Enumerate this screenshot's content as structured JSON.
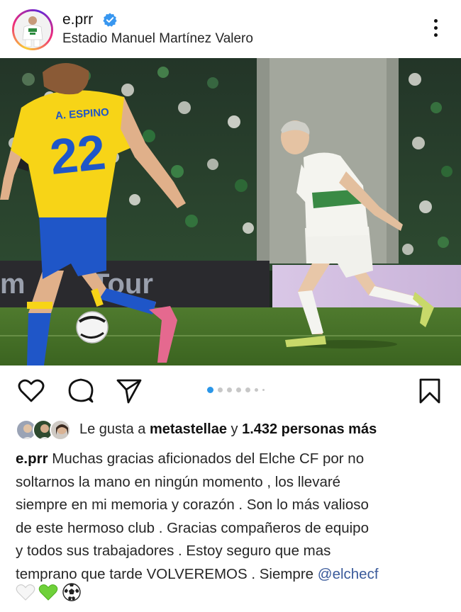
{
  "post": {
    "username": "e.prr",
    "verified": true,
    "location": "Estadio Manuel Martínez Valero"
  },
  "photo": {
    "player_number": "22",
    "player_name": "A. ESPINO",
    "board_text": "Tour",
    "board_text_left": "m"
  },
  "carousel": {
    "count": 7,
    "active_index": 0
  },
  "likes": {
    "prefix": "Le gusta a",
    "liked_by": "metastellae",
    "conjunction": "y",
    "others": "1.432 personas más"
  },
  "caption": {
    "username": "e.prr",
    "line1": " Muchas gracias  aficionados del Elche CF por no",
    "line2": "soltarnos la mano en ningún momento , los llevaré",
    "line3": "siempre en mi memoria y corazón . Son lo más valioso",
    "line4": "de este hermoso club .  Gracias compañeros de equipo",
    "line5": "y todos sus trabajadores . Estoy seguro que mas",
    "line6": "temprano que tarde VOLVEREMOS .  Siempre ",
    "mention": "@elchecf",
    "emojis": [
      "white-heart",
      "green-heart",
      "soccer-ball"
    ]
  },
  "icons": {
    "like": "heart-icon",
    "comment": "comment-icon",
    "share": "send-icon",
    "save": "bookmark-icon",
    "more": "more-vertical-icon",
    "verified": "verified-badge-icon"
  },
  "colors": {
    "verified_blue": "#3897f0",
    "carousel_active": "#2a96e8",
    "elche_green": "#1f8a3b",
    "cadiz_yellow": "#f7d417",
    "cadiz_blue": "#1f56c8"
  }
}
